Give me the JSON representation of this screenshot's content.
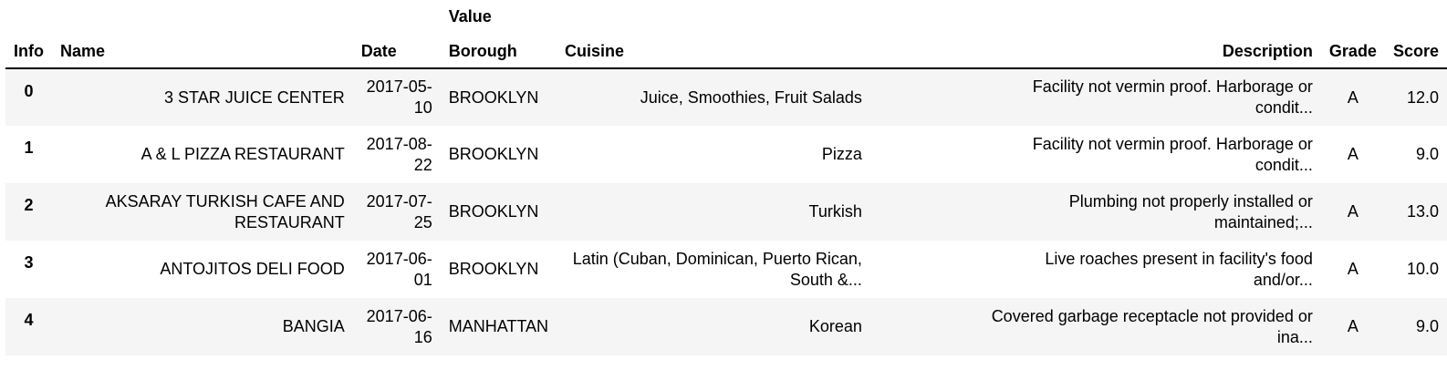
{
  "table": {
    "group_header": "Value",
    "index_header": "Info",
    "columns": [
      "Name",
      "Date",
      "Borough",
      "Cuisine",
      "Description",
      "Grade",
      "Score"
    ],
    "rows": [
      {
        "index": "0",
        "name": "3 STAR JUICE CENTER",
        "date": "2017-05-10",
        "borough": "BROOKLYN",
        "cuisine": "Juice, Smoothies, Fruit Salads",
        "description": "Facility not vermin proof. Harborage or condit...",
        "grade": "A",
        "score": "12.0"
      },
      {
        "index": "1",
        "name": "A & L PIZZA RESTAURANT",
        "date": "2017-08-22",
        "borough": "BROOKLYN",
        "cuisine": "Pizza",
        "description": "Facility not vermin proof. Harborage or condit...",
        "grade": "A",
        "score": "9.0"
      },
      {
        "index": "2",
        "name": "AKSARAY TURKISH CAFE AND RESTAURANT",
        "date": "2017-07-25",
        "borough": "BROOKLYN",
        "cuisine": "Turkish",
        "description": "Plumbing not properly installed or maintained;...",
        "grade": "A",
        "score": "13.0"
      },
      {
        "index": "3",
        "name": "ANTOJITOS DELI FOOD",
        "date": "2017-06-01",
        "borough": "BROOKLYN",
        "cuisine": "Latin (Cuban, Dominican, Puerto Rican, South &...",
        "description": "Live roaches present in facility's food and/or...",
        "grade": "A",
        "score": "10.0"
      },
      {
        "index": "4",
        "name": "BANGIA",
        "date": "2017-06-16",
        "borough": "MANHATTAN",
        "cuisine": "Korean",
        "description": "Covered garbage receptacle not provided or ina...",
        "grade": "A",
        "score": "9.0"
      }
    ]
  }
}
